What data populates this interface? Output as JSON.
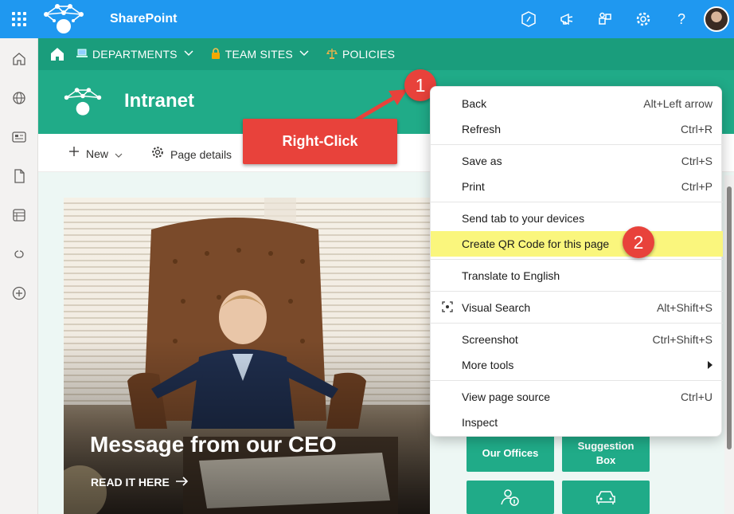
{
  "suitebar": {
    "title": "SharePoint",
    "icons": [
      "code-icon",
      "megaphone-icon",
      "apps-icon",
      "gear-icon",
      "help-icon"
    ],
    "help_glyph": "?"
  },
  "leftrail": {
    "icons": [
      "home-icon",
      "globe-icon",
      "news-icon",
      "file-icon",
      "list-icon",
      "link-icon",
      "add-icon"
    ]
  },
  "hubnav": {
    "items": [
      {
        "label": "DEPARTMENTS",
        "icon": "laptop-icon"
      },
      {
        "label": "TEAM SITES",
        "icon": "lock-icon"
      },
      {
        "label": "POLICIES",
        "icon": "scales-icon"
      }
    ]
  },
  "site": {
    "title": "Intranet"
  },
  "commandbar": {
    "new_label": "New",
    "page_details_label": "Page details"
  },
  "hero": {
    "title": "Message from our CEO",
    "link": "READ IT HERE"
  },
  "tiles": [
    {
      "label": "Our Offices"
    },
    {
      "label": "Suggestion Box"
    }
  ],
  "annotations": {
    "callout": "Right-Click",
    "badge1": "1",
    "badge2": "2",
    "color": "#e8423b"
  },
  "context_menu": {
    "items": [
      {
        "label": "Back",
        "shortcut": "Alt+Left arrow"
      },
      {
        "label": "Refresh",
        "shortcut": "Ctrl+R"
      },
      {
        "label": "Save as",
        "shortcut": "Ctrl+S"
      },
      {
        "label": "Print",
        "shortcut": "Ctrl+P"
      },
      {
        "label": "Send tab to your devices",
        "shortcut": ""
      },
      {
        "label": "Create QR Code for this page",
        "shortcut": ""
      },
      {
        "label": "Translate to English",
        "shortcut": ""
      },
      {
        "label": "Visual Search",
        "shortcut": "Alt+Shift+S"
      },
      {
        "label": "Screenshot",
        "shortcut": "Ctrl+Shift+S"
      },
      {
        "label": "More tools",
        "shortcut": ""
      },
      {
        "label": "View page source",
        "shortcut": "Ctrl+U"
      },
      {
        "label": "Inspect",
        "shortcut": ""
      }
    ],
    "highlight_color": "#faf67d"
  },
  "colors": {
    "suitebar": "#1f98f0",
    "hubnav": "#1a9d7c",
    "siteheader": "#20ab88"
  }
}
